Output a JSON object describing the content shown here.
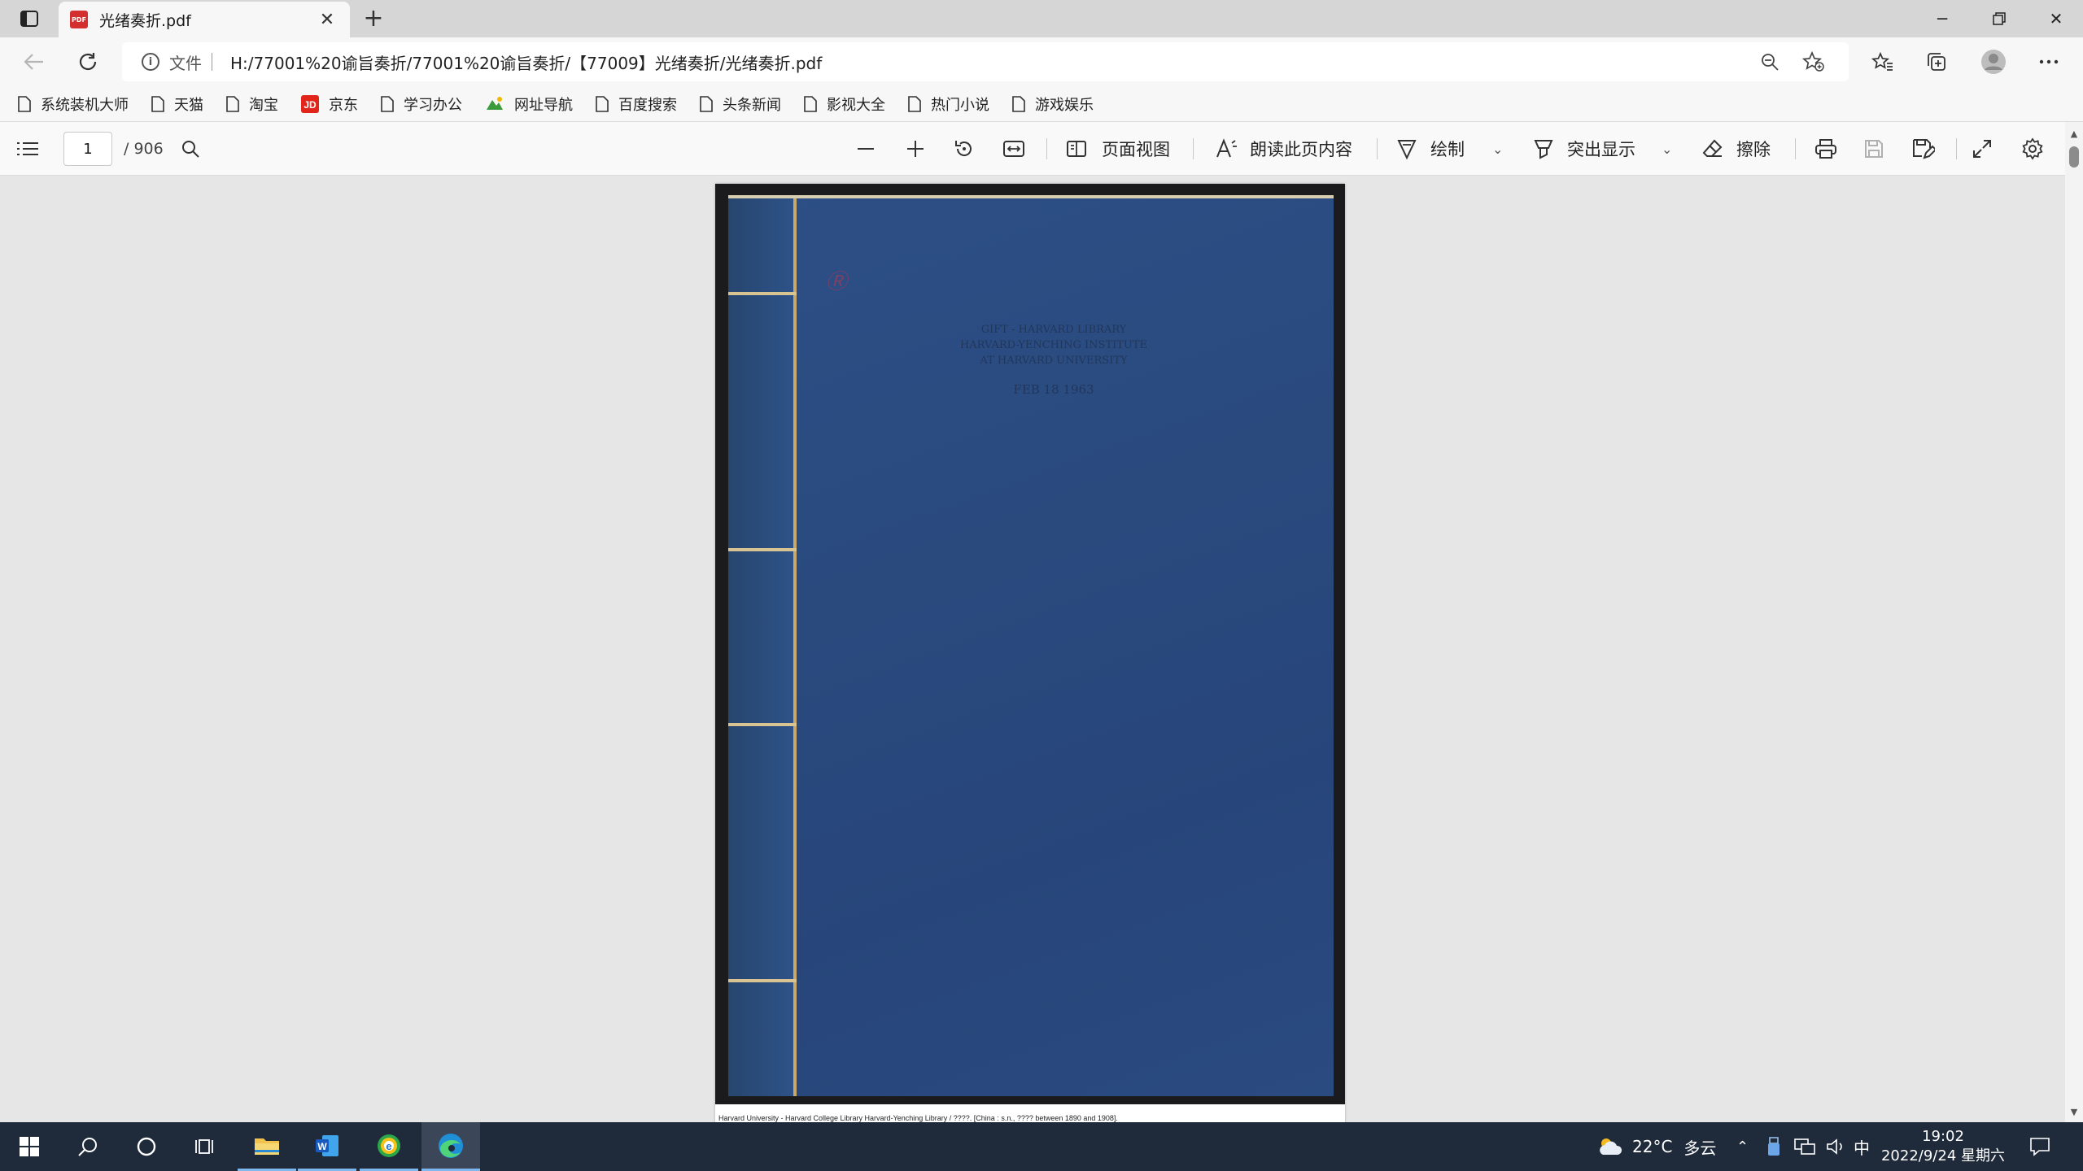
{
  "browser": {
    "tab": {
      "title": "光绪奏折.pdf",
      "icon": "pdf-icon"
    },
    "window_controls": [
      "minimize-icon",
      "restore-icon",
      "close-icon"
    ],
    "address": {
      "scheme_label": "文件",
      "url": "H:/77001%20谕旨奏折/77001%20谕旨奏折/【77009】光绪奏折/光绪奏折.pdf"
    },
    "bookmarks": [
      {
        "label": "系统装机大师",
        "icon": "page-icon"
      },
      {
        "label": "天猫",
        "icon": "page-icon"
      },
      {
        "label": "淘宝",
        "icon": "page-icon"
      },
      {
        "label": "京东",
        "icon": "jd-icon"
      },
      {
        "label": "学习办公",
        "icon": "page-icon"
      },
      {
        "label": "网址导航",
        "icon": "nav-site-icon"
      },
      {
        "label": "百度搜索",
        "icon": "page-icon"
      },
      {
        "label": "头条新闻",
        "icon": "page-icon"
      },
      {
        "label": "影视大全",
        "icon": "page-icon"
      },
      {
        "label": "热门小说",
        "icon": "page-icon"
      },
      {
        "label": "游戏娱乐",
        "icon": "page-icon"
      }
    ]
  },
  "pdf_toolbar": {
    "current_page": "1",
    "total_pages": "/ 906",
    "page_view": "页面视图",
    "read_aloud": "朗读此页内容",
    "draw": "绘制",
    "highlight": "突出显示",
    "erase": "擦除"
  },
  "document": {
    "cover_stamp_lines": [
      "GIFT - HARVARD LIBRARY",
      "HARVARD-YENCHING INSTITUTE",
      "AT HARVARD UNIVERSITY"
    ],
    "cover_stamp_date": "FEB 18 1963",
    "cover_seal_text": "Ⓡ",
    "caption": "Harvard University - Harvard College Library Harvard-Yenching Library / ????. [China : s.n., ???? between 1890 and 1908]."
  },
  "taskbar": {
    "weather_temp": "22°C",
    "weather_desc": "多云",
    "ime": "中",
    "time": "19:02",
    "date": "2022/9/24 星期六"
  },
  "colors": {
    "cover_blue": "#2a4a7e",
    "pdf_red": "#d32f2f",
    "taskbar_bg": "#1f2a3a"
  }
}
